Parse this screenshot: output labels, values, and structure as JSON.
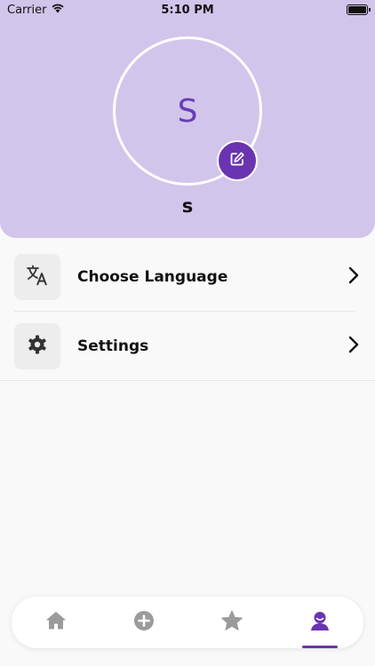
{
  "status_bar": {
    "carrier": "Carrier",
    "time": "5:10 PM"
  },
  "profile": {
    "avatar_initial": "S",
    "name": "s",
    "edit_icon": "edit-icon"
  },
  "menu": {
    "items": [
      {
        "label": "Choose Language",
        "icon": "translate-icon"
      },
      {
        "label": "Settings",
        "icon": "gear-icon"
      }
    ]
  },
  "bottom_nav": {
    "tabs": [
      {
        "icon": "home-icon",
        "active": false
      },
      {
        "icon": "plus-circle-icon",
        "active": false
      },
      {
        "icon": "star-icon",
        "active": false
      },
      {
        "icon": "profile-icon",
        "active": true
      }
    ]
  },
  "colors": {
    "header_bg": "#d2c5eb",
    "accent": "#6a34b0",
    "inactive_icon": "#9b9b9b"
  }
}
